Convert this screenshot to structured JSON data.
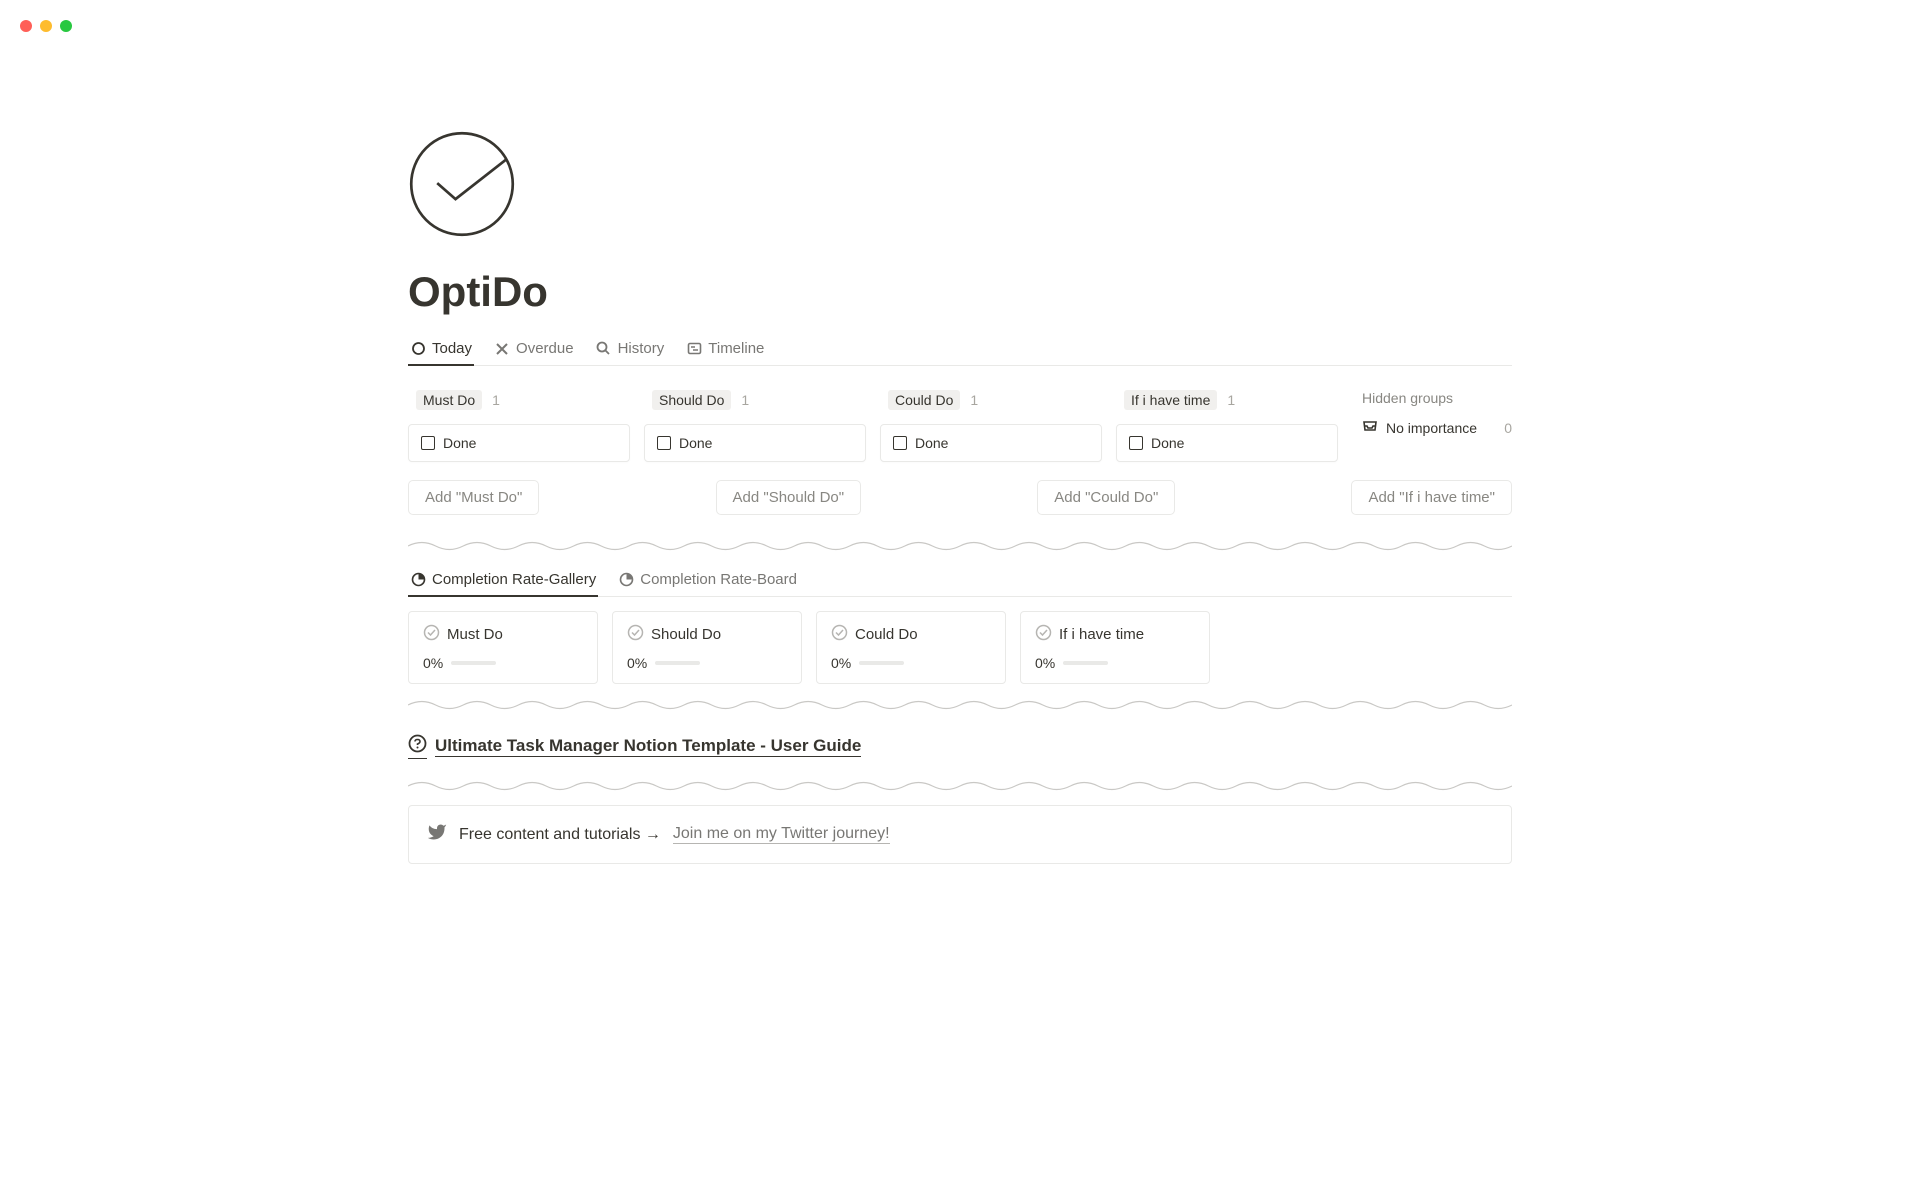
{
  "page": {
    "title": "OptiDo"
  },
  "tabs": [
    {
      "label": "Today",
      "icon": "circle"
    },
    {
      "label": "Overdue",
      "icon": "x"
    },
    {
      "label": "History",
      "icon": "search"
    },
    {
      "label": "Timeline",
      "icon": "timeline"
    }
  ],
  "columns": [
    {
      "name": "Must Do",
      "count": "1",
      "card": {
        "title": "Done"
      },
      "add_label": "Add \"Must Do\""
    },
    {
      "name": "Should Do",
      "count": "1",
      "card": {
        "title": "Done"
      },
      "add_label": "Add \"Should Do\""
    },
    {
      "name": "Could Do",
      "count": "1",
      "card": {
        "title": "Done"
      },
      "add_label": "Add \"Could Do\""
    },
    {
      "name": "If i have time",
      "count": "1",
      "card": {
        "title": "Done"
      },
      "add_label": "Add \"If i have time\""
    }
  ],
  "hidden": {
    "title": "Hidden groups",
    "item": {
      "label": "No importance",
      "count": "0"
    }
  },
  "completion_tabs": [
    {
      "label": "Completion Rate-Gallery"
    },
    {
      "label": "Completion Rate-Board"
    }
  ],
  "gallery": [
    {
      "title": "Must Do",
      "percent": "0%"
    },
    {
      "title": "Should Do",
      "percent": "0%"
    },
    {
      "title": "Could Do",
      "percent": "0%"
    },
    {
      "title": "If i have time",
      "percent": "0%"
    }
  ],
  "user_guide": {
    "title": "Ultimate Task Manager Notion Template - User Guide"
  },
  "twitter": {
    "prefix": "Free content and tutorials →",
    "link": "Join me on my Twitter journey!"
  }
}
